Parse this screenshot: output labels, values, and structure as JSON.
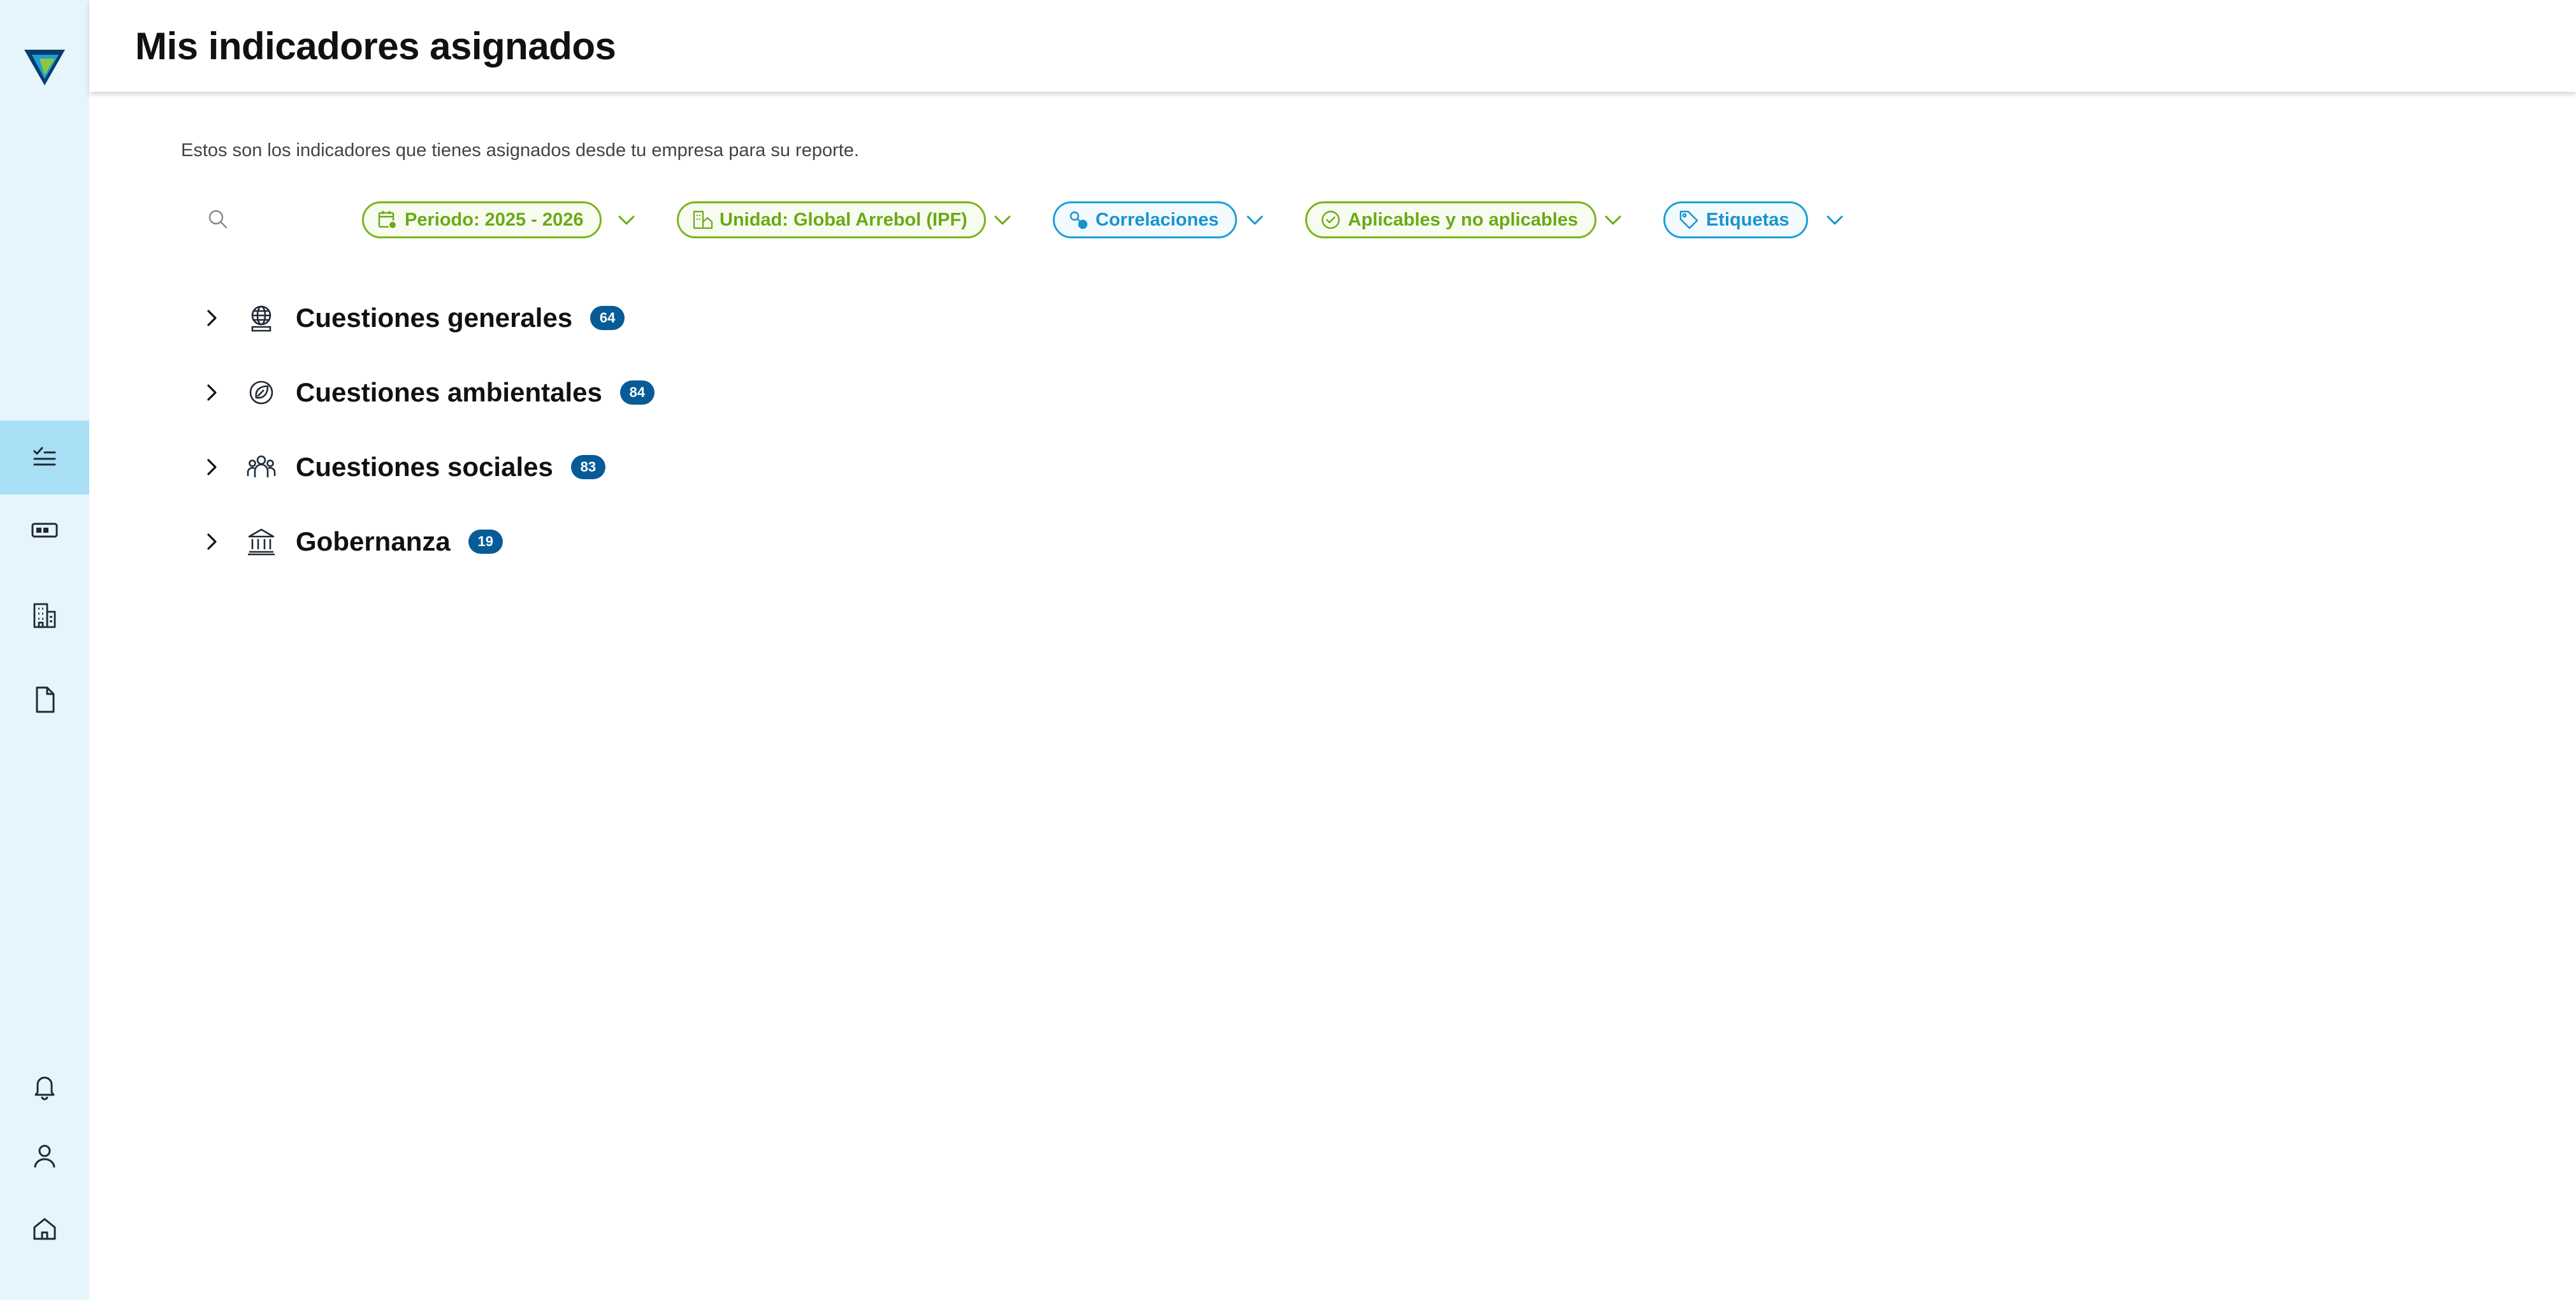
{
  "app": {
    "logo_icon": "brand-logo",
    "colors": {
      "accent_green": "#7ab51d",
      "accent_blue": "#1d9fd8",
      "badge": "#075c97",
      "sidebar_bg": "#e6f5fc",
      "sidebar_active": "#a9dff5"
    }
  },
  "header": {
    "title": "Mis indicadores asignados"
  },
  "sidebar": {
    "top_items": [
      {
        "icon": "checklist-icon",
        "active": true
      },
      {
        "icon": "card-icon",
        "active": false
      },
      {
        "icon": "building-icon",
        "active": false
      },
      {
        "icon": "document-icon",
        "active": false
      }
    ],
    "bottom_items": [
      {
        "icon": "bell-icon"
      },
      {
        "icon": "user-icon"
      },
      {
        "icon": "home-icon"
      }
    ]
  },
  "main": {
    "intro": "Estos son los indicadores que tienes asignados desde tu empresa para su reporte.",
    "filters": {
      "period": {
        "label": "Periodo: 2025 - 2026",
        "icon": "calendar-icon"
      },
      "unit": {
        "label": "Unidad: Global Arrebol (IPF)",
        "icon": "office-icon"
      },
      "correlations": {
        "label": "Correlaciones",
        "icon": "link-icon"
      },
      "applicability": {
        "label": "Aplicables y no aplicables",
        "icon": "check-circle-icon"
      },
      "tags": {
        "label": "Etiquetas",
        "icon": "tag-icon"
      }
    },
    "categories": [
      {
        "label": "Cuestiones generales",
        "count": "64",
        "icon": "globe-icon"
      },
      {
        "label": "Cuestiones ambientales",
        "count": "84",
        "icon": "leaf-icon"
      },
      {
        "label": "Cuestiones sociales",
        "count": "83",
        "icon": "people-icon"
      },
      {
        "label": "Gobernanza",
        "count": "19",
        "icon": "institution-icon"
      }
    ]
  }
}
